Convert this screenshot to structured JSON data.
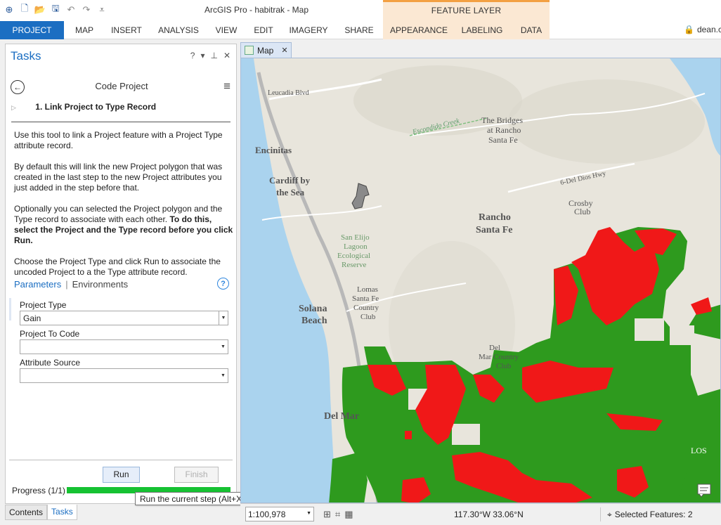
{
  "title_bar": {
    "app_title": "ArcGIS Pro - habitrak - Map",
    "contextual_tab_group": "FEATURE LAYER",
    "user": "dean.c"
  },
  "ribbon": {
    "tabs": [
      "PROJECT",
      "MAP",
      "INSERT",
      "ANALYSIS",
      "VIEW",
      "EDIT",
      "IMAGERY",
      "SHARE",
      "APPEARANCE",
      "LABELING",
      "DATA"
    ]
  },
  "tasks_pane": {
    "title": "Tasks",
    "task_name": "Code Project",
    "step": "1.  Link Project to Type Record",
    "instructions": {
      "p1": "Use this tool to link a Project feature with a Project Type attribute record.",
      "p2": "By default this will link the new Project polygon that was created in the last step to the new Project attributes you just added in the step before that.",
      "p3_plain": "Optionally you can selected the Project polygon and the Type record to associate with each other.",
      "p3_bold": "To do this, select the Project and the Type record before you click Run.",
      "p4": "Choose the Project Type and click Run to associate the uncoded Project to a the Type attribute record."
    },
    "param_tabs": {
      "active": "Parameters",
      "inactive": "Environments"
    },
    "params": {
      "project_type_label": "Project Type",
      "project_type_value": "Gain",
      "project_to_code_label": "Project To Code",
      "project_to_code_value": "",
      "attribute_source_label": "Attribute Source",
      "attribute_source_value": ""
    },
    "run_label": "Run",
    "finish_label": "Finish",
    "progress_label": "Progress (1/1)",
    "progress_fraction": 1.0,
    "tooltip": "Run the current step (Alt+X)",
    "bottom_tabs": [
      "Contents",
      "Tasks"
    ]
  },
  "map": {
    "tab_label": "Map",
    "labels": {
      "leucadia": "Leucadia Blvd",
      "encinitas": "Encinitas",
      "cardiff1": "Cardiff by",
      "cardiff2": "the Sea",
      "bridges1": "The Bridges",
      "bridges2": "at Rancho",
      "bridges3": "Santa Fe",
      "escondido": "Escondido Creek",
      "deldios": "6-Del Dios Hwy",
      "rancho1": "Rancho",
      "rancho2": "Santa Fe",
      "crosby1": "Crosby",
      "crosby2": "Club",
      "sanelijo1": "San Elijo",
      "sanelijo2": "Lagoon",
      "sanelijo3": "Ecological",
      "sanelijo4": "Reserve",
      "lomas1": "Lomas",
      "lomas2": "Santa Fe",
      "lomas3": "Country",
      "lomas4": "Club",
      "solana1": "Solana",
      "solana2": "Beach",
      "delmarcc1": "Del",
      "delmarcc2": "Mar Country",
      "delmarcc3": "Club",
      "delmar": "Del Mar",
      "los": "LOS"
    },
    "colors": {
      "water": "#aad3ee",
      "land": "#e8e5dc",
      "habitat_gain": "#2e9a1e",
      "habitat_loss": "#f01818"
    }
  },
  "status_bar": {
    "scale": "1:100,978",
    "coordinates": "117.30°W 33.06°N",
    "selected_features": "Selected Features: 2"
  }
}
